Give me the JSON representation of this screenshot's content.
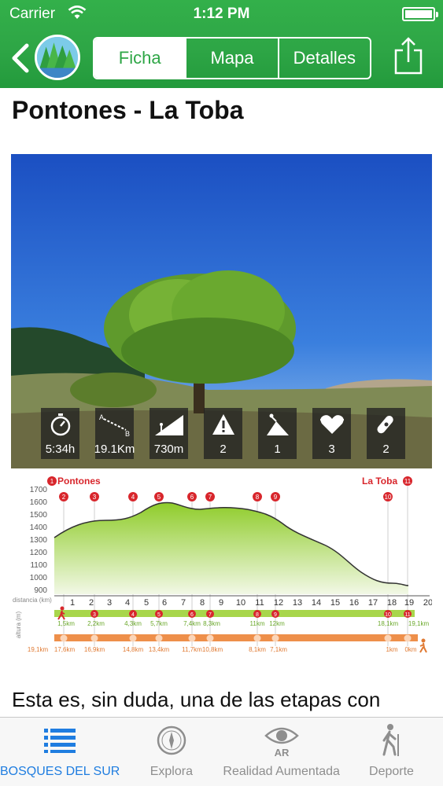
{
  "status_bar": {
    "carrier": "Carrier",
    "time": "1:12 PM"
  },
  "nav": {
    "tabs": [
      {
        "label": "Ficha",
        "selected": true
      },
      {
        "label": "Mapa",
        "selected": false
      },
      {
        "label": "Detalles",
        "selected": false
      }
    ],
    "back_icon": "chevron-left-icon",
    "share_icon": "share-icon",
    "logo_icon": "forest-logo-icon"
  },
  "route": {
    "title": "Pontones - La Toba",
    "stats": [
      {
        "icon": "stopwatch-icon",
        "value": "5:34h"
      },
      {
        "icon": "distance-icon",
        "value": "19.1Km"
      },
      {
        "icon": "ascent-icon",
        "value": "730m"
      },
      {
        "icon": "warning-icon",
        "value": "2"
      },
      {
        "icon": "terrain-icon",
        "value": "1"
      },
      {
        "icon": "heart-icon",
        "value": "3"
      },
      {
        "icon": "gear-icon",
        "value": "2"
      }
    ]
  },
  "profile": {
    "start_label": "Pontones",
    "end_label": "La Toba",
    "yticks": [
      "1700",
      "1600",
      "1500",
      "1400",
      "1300",
      "1200",
      "1100",
      "1000",
      "900"
    ],
    "xticks": [
      "1",
      "2",
      "3",
      "4",
      "5",
      "6",
      "7",
      "8",
      "9",
      "10",
      "11",
      "12",
      "13",
      "14",
      "15",
      "16",
      "17",
      "18",
      "19",
      "20"
    ],
    "xaxis_label": "distancia (km)",
    "yaxis_label": "altura (m)",
    "forward": [
      "1,5km",
      "2,2km",
      "4,3km",
      "5,7km",
      "7,4km",
      "8,3km",
      "11km",
      "12km",
      "18,1km",
      "19,1km"
    ],
    "reverse": [
      "19,1km",
      "17,6km",
      "16,9km",
      "14,8km",
      "13,4km",
      "11,7km",
      "10,8km",
      "8,1km",
      "7,1km",
      "1km",
      "0km"
    ],
    "colors": {
      "fill": "#9bd43a",
      "forward_bar": "#a8d64b",
      "reverse_bar": "#ee8f4a",
      "marker": "#d8262c"
    }
  },
  "description": "Esta es, sin duda, una de las etapas con",
  "tabbar": [
    {
      "label": "BOSQUES DEL SUR",
      "icon": "list-icon",
      "active": true
    },
    {
      "label": "Explora",
      "icon": "compass-icon",
      "active": false
    },
    {
      "label": "Realidad Aumentada",
      "icon": "eye-ar-icon",
      "active": false
    },
    {
      "label": "Deporte",
      "icon": "hiker-icon",
      "active": false
    }
  ]
}
